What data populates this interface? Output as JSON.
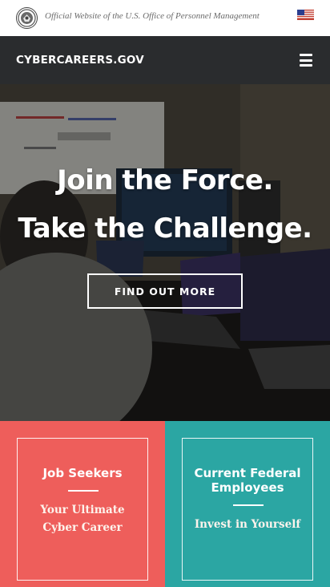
{
  "official_banner": {
    "text": "Official Website of the U.S. Office of Personnel Management",
    "seal_icon": "opm-seal-icon",
    "flag_icon": "us-flag-icon"
  },
  "header": {
    "site_title": "CYBERCAREERS.GOV",
    "menu_icon": "hamburger-menu-icon",
    "background": "#2a2c2e"
  },
  "hero": {
    "line1": "Join the Force.",
    "line2": "Take the Challenge.",
    "cta_label": "FIND OUT MORE"
  },
  "cards": [
    {
      "title": "Job Seekers",
      "subtitle_line1": "Your Ultimate",
      "subtitle_line2": "Cyber Career",
      "color": "#ee5e5b"
    },
    {
      "title_line1": "Current Federal",
      "title_line2": "Employees",
      "subtitle": "Invest in Yourself",
      "color": "#2ba6a3"
    }
  ]
}
